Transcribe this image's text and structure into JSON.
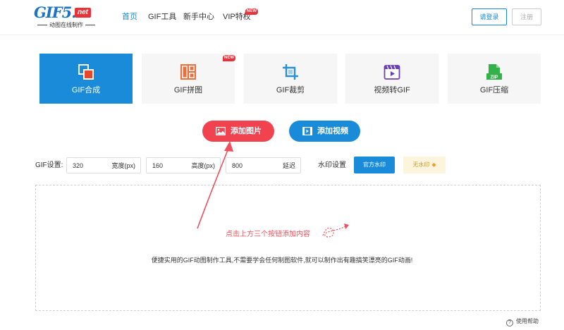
{
  "logo": {
    "main": "GIF5.",
    "net": "net",
    "tagline": "动图在线制作"
  },
  "nav": {
    "items": [
      {
        "label": "首页",
        "active": true
      },
      {
        "label": "GIF工具",
        "active": false
      },
      {
        "label": "新手中心",
        "active": false
      },
      {
        "label": "VIP特权",
        "active": false
      }
    ],
    "new_badge": "NEW"
  },
  "auth": {
    "login": "请登录",
    "register": "注册"
  },
  "tools": [
    {
      "label": "GIF合成",
      "icon": "gif-compose-icon",
      "active": true
    },
    {
      "label": "GIF拼图",
      "icon": "gif-puzzle-icon",
      "badge": "NEW"
    },
    {
      "label": "GIF裁剪",
      "icon": "crop-icon"
    },
    {
      "label": "视频转GIF",
      "icon": "video-to-gif-icon"
    },
    {
      "label": "GIF压缩",
      "icon": "zip-icon",
      "icon_text": "ZIP"
    }
  ],
  "actions": {
    "add_image": "添加图片",
    "add_video": "添加视频"
  },
  "settings": {
    "label": "GIF设置:",
    "width": {
      "value": "320",
      "unit": "宽度(px)"
    },
    "height": {
      "value": "160",
      "unit": "高度(px)"
    },
    "delay": {
      "value": "800",
      "unit": "延迟"
    }
  },
  "watermark": {
    "label": "水印设置",
    "official": "官方水印",
    "none": "无水印"
  },
  "dropzone": {
    "hint": "点击上方三个按钮添加内容",
    "description": "便捷实用的GIF动图制作工具,不需要学会任何制图软件,就可以制作出有趣搞笑漂亮的GIF动画!"
  },
  "help": {
    "label": "使用帮助"
  },
  "colors": {
    "primary": "#1a8bd8",
    "accent": "#f0434f",
    "new_badge": "#e8323a",
    "hint": "#ef4f5c"
  }
}
